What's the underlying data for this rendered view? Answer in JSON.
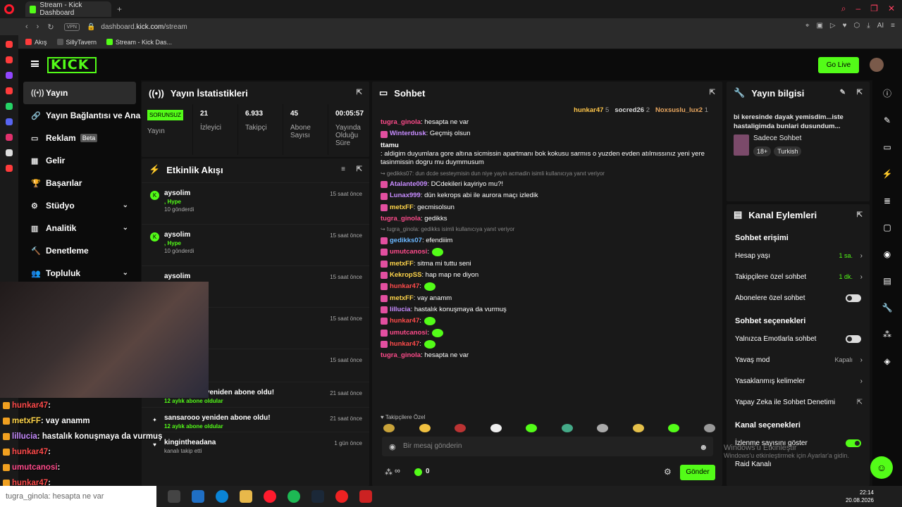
{
  "browser": {
    "tab_title": "Stream - Kick Dashboard",
    "url_prefix": "dashboard.",
    "url_domain": "kick.com",
    "url_path": "/stream",
    "vpn": "VPN",
    "ai": "AI",
    "bookmarks": [
      "Akış",
      "SillyTavern",
      "Stream - Kick Das..."
    ]
  },
  "header": {
    "logo": "KICK",
    "golive": "Go Live"
  },
  "nav": {
    "items": [
      {
        "label": "Yayın",
        "icon": "((•))"
      },
      {
        "label": "Yayın Bağlantısı ve Anahtar",
        "icon": "🔗"
      },
      {
        "label": "Reklam",
        "icon": "▭",
        "badge": "Beta"
      },
      {
        "label": "Gelir",
        "icon": "▦"
      },
      {
        "label": "Başarılar",
        "icon": "🏆"
      },
      {
        "label": "Stüdyo",
        "icon": "⚙",
        "chev": "⌄"
      },
      {
        "label": "Analitik",
        "icon": "▥",
        "chev": "⌄"
      },
      {
        "label": "Denetleme",
        "icon": "🔨"
      },
      {
        "label": "Topluluk",
        "icon": "👥",
        "chev": "⌄"
      }
    ]
  },
  "stats": {
    "title": "Yayın İstatistikleri",
    "status": "SORUNSUZ",
    "status_label": "Yayın",
    "items": [
      {
        "value": "21",
        "label": "İzleyici"
      },
      {
        "value": "6.933",
        "label": "Takipçi"
      },
      {
        "value": "45",
        "label": "Abone Sayısı"
      },
      {
        "value": "00:05:57",
        "label": "Yayında Olduğu Süre"
      }
    ]
  },
  "activity": {
    "title": "Etkinlik Akışı",
    "events": [
      {
        "user": "aysolim",
        "line1": ", Hype",
        "line2": "10 gönderdi",
        "time": "15 saat önce"
      },
      {
        "user": "aysolim",
        "line1": ", Hype",
        "line2": "10 gönderdi",
        "time": "15 saat önce"
      },
      {
        "user": "aysolim",
        "line1": "",
        "line2": "",
        "time": "15 saat önce"
      },
      {
        "user": "",
        "line1": "",
        "line2": "",
        "time": "15 saat önce"
      },
      {
        "user": "",
        "line1": "",
        "line2": "",
        "time": "15 saat önce"
      },
      {
        "user": "umutcanosi yeniden abone oldu!",
        "line1": "12 aylık abone oldular",
        "line2": "",
        "time": "21 saat önce"
      },
      {
        "user": "sansarooo yeniden abone oldu!",
        "line1": "12 aylık abone oldular",
        "line2": "",
        "time": "21 saat önce"
      },
      {
        "user": "kingintheadana",
        "line1": "kanalı takip etti",
        "line2": "",
        "time": "1 gün önce"
      }
    ]
  },
  "chat": {
    "title": "Sohbet",
    "top": [
      {
        "name": "hunkar47",
        "n": "5"
      },
      {
        "name": "socred26",
        "n": "2"
      },
      {
        "name": "Noxsuslu_lux2",
        "n": "1"
      }
    ],
    "messages": [
      {
        "type": "msg",
        "user": "tugra_ginola",
        "color": "#ff4b8b",
        "text": ": hesapta ne var"
      },
      {
        "type": "msg",
        "user": "Winterdusk",
        "color": "#c78cff",
        "text": ": Geçmiş olsun"
      },
      {
        "type": "msg",
        "user": "ttamu",
        "color": "#ffffff",
        "text": ": aldigim duyumlara gore altına sicmissin apartmanı bok kokusu sarmıs o yuzden evden atılmıssınız yeni yere tasinmissin dogru mu duymmusum"
      },
      {
        "type": "reply",
        "text": "↪ gedikks07: dun dcde sesteymisin dun niye yayin acmadin isimli kullanıcıya yanıt veriyor"
      },
      {
        "type": "msg",
        "user": "Atalante009",
        "color": "#c78cff",
        "text": ": DCdekileri kayiriyo mu?!"
      },
      {
        "type": "msg",
        "user": "Lunax999",
        "color": "#c78cff",
        "text": ": dün kekrops abi ile aurora maçı izledik"
      },
      {
        "type": "msg",
        "user": "metxFF",
        "color": "#ffd54a",
        "text": ": gecmisolsun"
      },
      {
        "type": "msg",
        "user": "tugra_ginola",
        "color": "#ff4b8b",
        "text": ": gedikks"
      },
      {
        "type": "reply",
        "text": "↪ tugra_ginola: gedikks isimli kullanıcıya yanıt veriyor"
      },
      {
        "type": "msg",
        "user": "gedikks07",
        "color": "#6ab7ff",
        "text": ": efendiiim"
      },
      {
        "type": "msg",
        "user": "umutcanosi",
        "color": "#ff4b8b",
        "text": ":"
      },
      {
        "type": "msg",
        "user": "metxFF",
        "color": "#ffd54a",
        "text": ": sitma mi tuttu seni"
      },
      {
        "type": "msg",
        "user": "KekropSS",
        "color": "#ffd54a",
        "text": ": hap map ne diyon"
      },
      {
        "type": "msg",
        "user": "hunkar47",
        "color": "#ff4b4b",
        "text": ":"
      },
      {
        "type": "msg",
        "user": "metxFF",
        "color": "#ffd54a",
        "text": ": vay anamm"
      },
      {
        "type": "msg",
        "user": "lillucia",
        "color": "#c78cff",
        "text": ": hastalık konuşmaya da vurmuş"
      },
      {
        "type": "msg",
        "user": "hunkar47",
        "color": "#ff4b4b",
        "text": ":"
      },
      {
        "type": "msg",
        "user": "umutcanosi",
        "color": "#ff4b8b",
        "text": ":"
      },
      {
        "type": "msg",
        "user": "hunkar47",
        "color": "#ff4b4b",
        "text": ":"
      },
      {
        "type": "msg",
        "user": "tugra_ginola",
        "color": "#ff4b8b",
        "text": ": hesapta ne var"
      }
    ],
    "followers_only": "♥ Takipçilere Özel",
    "placeholder": "Bir mesaj gönderin",
    "viewer_count": "∞",
    "kicks": "0",
    "send": "Gönder"
  },
  "info": {
    "title": "Yayın bilgisi",
    "stream_title": "bi keresinde dayak yemisdim...iste hastaligimda bunlari dusundum...",
    "category": "Sadece Sohbet",
    "tags": [
      "18+",
      "Turkish"
    ]
  },
  "actions": {
    "title": "Kanal Eylemleri",
    "chat_access": "Sohbet erişimi",
    "account_age": {
      "label": "Hesap yaşı",
      "value": "1 sa."
    },
    "followers_chat": {
      "label": "Takipçilere özel sohbet",
      "value": "1 dk."
    },
    "subs_chat": "Abonelere özel sohbet",
    "chat_options": "Sohbet seçenekleri",
    "emote_only": "Yalnızca Emotlarla sohbet",
    "slow_mode": {
      "label": "Yavaş mod",
      "value": "Kapalı"
    },
    "banned_words": "Yasaklanmış kelimeler",
    "ai_mod": "Yapay Zeka ile Sohbet Denetimi",
    "channel_options": "Kanal seçenekleri",
    "viewer_count": "İzlenme sayısını göster",
    "raid": "Raid Kanalı"
  },
  "overlay": [
    {
      "user": "hunkar47",
      "color": "#ff4b4b",
      "text": " :"
    },
    {
      "user": "metxFF",
      "color": "#ffd54a",
      "text": " : vay anamm"
    },
    {
      "user": "lillucia",
      "color": "#c78cff",
      "text": " : hastalık konuşmaya da vurmuş"
    },
    {
      "user": "hunkar47",
      "color": "#ff4b4b",
      "text": " :"
    },
    {
      "user": "umutcanosi",
      "color": "#ff4b8b",
      "text": " :"
    },
    {
      "user": "hunkar47",
      "color": "#ff4b4b",
      "text": " :"
    }
  ],
  "taskbar": {
    "search_text": "tugra_ginola: hesapta ne var",
    "time": "22:14",
    "date": "20.08.2026"
  },
  "watermark": {
    "title": "Windows'u Etkinleştir",
    "sub": "Windows'u etkinleştirmek için Ayarlar'a gidin."
  }
}
